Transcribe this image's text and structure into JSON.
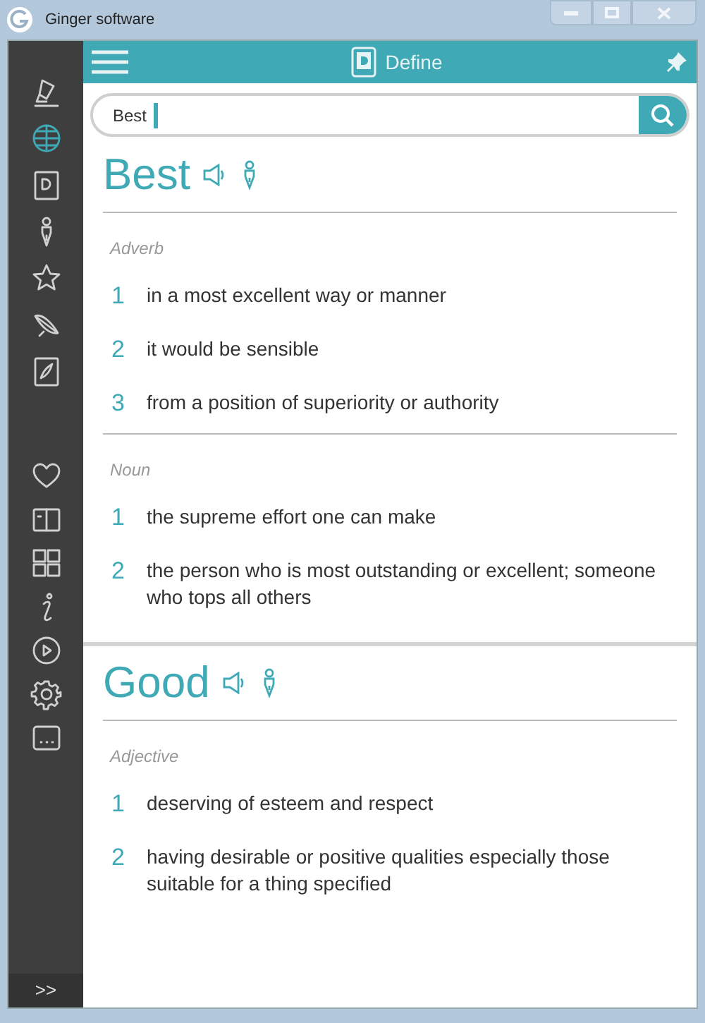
{
  "window": {
    "title": "Ginger software"
  },
  "header": {
    "title": "Define"
  },
  "search": {
    "value": "Best"
  },
  "sidebar": {
    "top_items": [
      {
        "selected": false
      },
      {
        "selected": true
      },
      {
        "selected": false
      },
      {
        "selected": false
      },
      {
        "selected": false
      },
      {
        "selected": false
      },
      {
        "selected": false
      }
    ],
    "bottom_items": [
      {
        "selected": false
      },
      {
        "selected": false
      },
      {
        "selected": false
      },
      {
        "selected": false
      },
      {
        "selected": false
      },
      {
        "selected": false
      },
      {
        "selected": false
      }
    ],
    "expand": ">>"
  },
  "entries": [
    {
      "word": "Best",
      "groups": [
        {
          "part_of_speech": "Adverb",
          "senses": [
            {
              "number": "1",
              "text": "in a most excellent way or manner"
            },
            {
              "number": "2",
              "text": "it would be sensible"
            },
            {
              "number": "3",
              "text": "from a position of superiority or authority"
            }
          ]
        },
        {
          "part_of_speech": "Noun",
          "senses": [
            {
              "number": "1",
              "text": "the supreme effort one can make"
            },
            {
              "number": "2",
              "text": "the person who is most outstanding or excellent; someone who tops all others"
            }
          ]
        }
      ]
    },
    {
      "word": "Good",
      "groups": [
        {
          "part_of_speech": "Adjective",
          "senses": [
            {
              "number": "1",
              "text": "deserving of esteem and respect"
            },
            {
              "number": "2",
              "text": "having desirable or positive qualities especially those suitable for a thing specified"
            }
          ]
        }
      ]
    }
  ]
}
